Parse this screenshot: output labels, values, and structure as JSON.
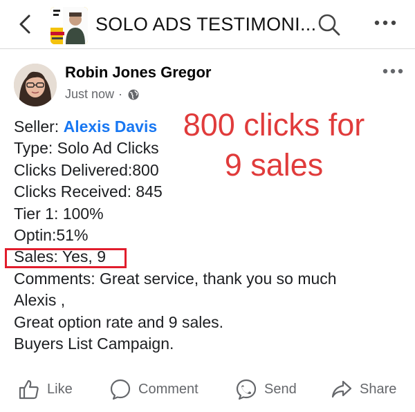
{
  "header": {
    "title": "SOLO ADS TESTIMONI...",
    "back_icon": "chevron-left-icon",
    "search_icon": "search-icon",
    "more_icon": "more-horizontal-icon"
  },
  "post": {
    "author": "Robin Jones Gregor",
    "timestamp": "Just now",
    "separator": "·",
    "audience_icon": "globe-icon",
    "lines": [
      {
        "prefix": "Seller: ",
        "link": "Alexis Davis"
      },
      {
        "text": "Type: Solo Ad Clicks"
      },
      {
        "text": "Clicks Delivered:800"
      },
      {
        "text": "Clicks Received: 845"
      },
      {
        "text": "Tier 1: 100%"
      },
      {
        "text": "Optin:51%"
      },
      {
        "text": "Sales: Yes, 9"
      },
      {
        "text": "Comments: Great service, thank you so much"
      },
      {
        "text": "Alexis ,"
      },
      {
        "text": "Great option rate and 9 sales."
      },
      {
        "text": "Buyers List Campaign."
      }
    ],
    "overlay": {
      "line1": "800 clicks for",
      "line2": "9 sales",
      "color": "#e03b3b"
    },
    "highlight_color": "#e11d2c"
  },
  "actions": {
    "like": "Like",
    "comment": "Comment",
    "send": "Send",
    "share": "Share"
  },
  "colors": {
    "link": "#1877f2",
    "muted": "#65676b",
    "text": "#1c1e21"
  }
}
